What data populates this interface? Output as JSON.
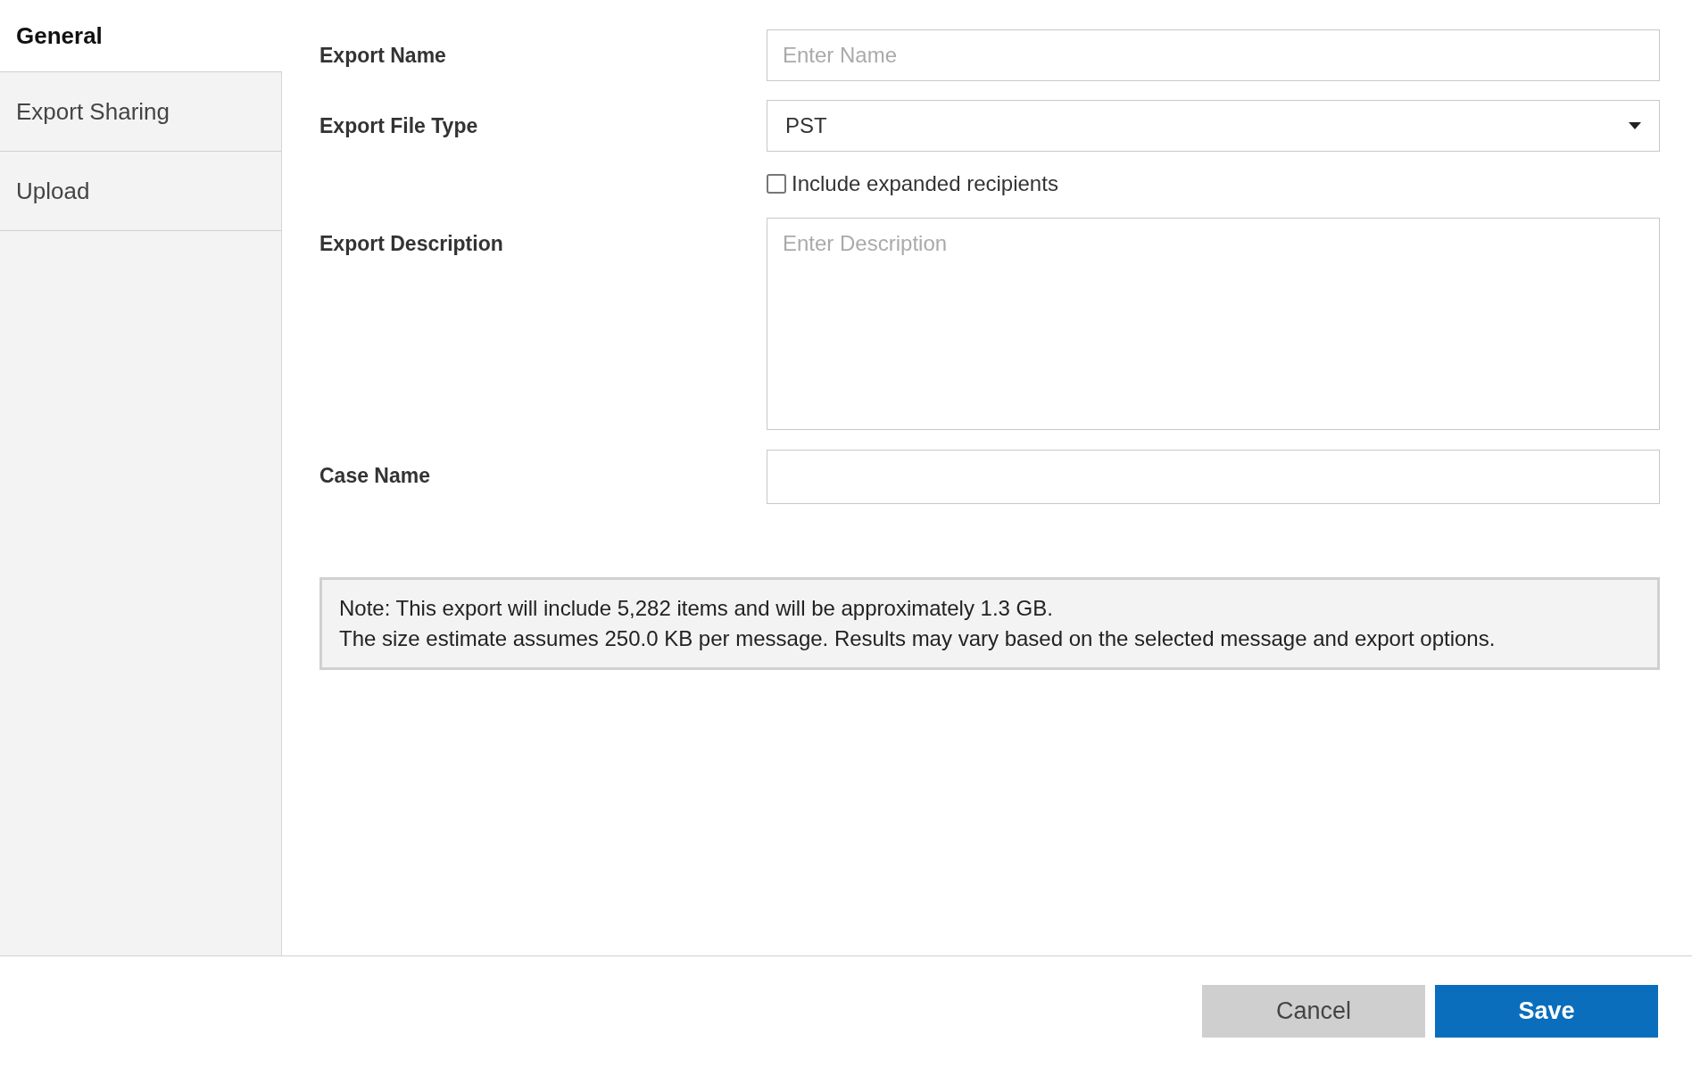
{
  "sidebar": {
    "tabs": [
      {
        "label": "General",
        "selected": true
      },
      {
        "label": "Export Sharing",
        "selected": false
      },
      {
        "label": "Upload",
        "selected": false
      }
    ]
  },
  "form": {
    "export_name": {
      "label": "Export Name",
      "placeholder": "Enter Name"
    },
    "export_file_type": {
      "label": "Export File Type",
      "value": "PST"
    },
    "include_expanded_recipients": {
      "label": "Include expanded recipients",
      "checked": false
    },
    "export_description": {
      "label": "Export Description",
      "placeholder": "Enter Description"
    },
    "case_name": {
      "label": "Case Name"
    }
  },
  "note": {
    "lines": [
      "Note: This export will include 5,282 items and will be approximately 1.3 GB.",
      "The size estimate assumes 250.0 KB per message. Results may vary based on the selected message and export options."
    ]
  },
  "buttons": {
    "cancel": "Cancel",
    "save": "Save"
  }
}
